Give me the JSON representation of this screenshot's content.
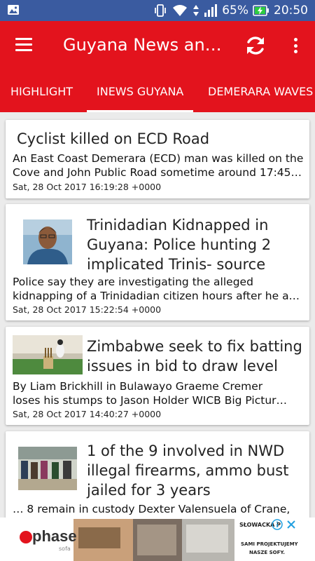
{
  "status_bar": {
    "battery_percent": "65%",
    "time": "20:50"
  },
  "app_bar": {
    "title": "Guyana News and..."
  },
  "tabs": [
    {
      "label": "HIGHLIGHT",
      "active": false
    },
    {
      "label": "INEWS GUYANA",
      "active": true
    },
    {
      "label": "DEMERARA WAVES",
      "active": false
    }
  ],
  "articles": [
    {
      "headline": "Cyclist killed on ECD Road",
      "summary_line1": "An East Coast Demerara (ECD) man was killed on the",
      "summary_line2": "Cove and John Public Road sometime around 17:45…",
      "date": "Sat, 28 Oct 2017 16:19:28 +0000"
    },
    {
      "headline_line1": "Trinidadian Kidnapped in",
      "headline_line2": "Guyana: Police hunting 2",
      "headline_line3": "implicated Trinis- source",
      "summary_line1": "Police say they are investigating the alleged",
      "summary_line2": "kidnapping of a Trinidadian citizen hours after he a…",
      "date": "Sat, 28 Oct 2017 15:22:54 +0000"
    },
    {
      "headline_line1": "Zimbabwe seek to fix batting",
      "headline_line2": "issues in bid to draw level",
      "summary_line1": "By Liam Brickhill in Bulawayo   Graeme Cremer",
      "summary_line2": "loses his stumps to Jason Holder WICB   Big Pictur…",
      "date": "Sat, 28 Oct 2017 14:40:27 +0000"
    },
    {
      "headline_line1": "1 of the 9 involved in NWD",
      "headline_line2": "illegal firearms, ammo bust",
      "headline_line3": "jailed for 3 years",
      "summary_line1": "… 8 remain in custody  Dexter Valensuela of Crane,"
    }
  ],
  "ad": {
    "brand": "phase",
    "brand_sub": "sofa",
    "right_top": "SŁOWACKA P",
    "right_line1": "SAMI PROJEKTUJEMY",
    "right_line2": "NASZE SOFY."
  },
  "colors": {
    "app_bar": "#e3131d",
    "status_bar": "#3a5ba0",
    "background": "#ebebeb"
  }
}
